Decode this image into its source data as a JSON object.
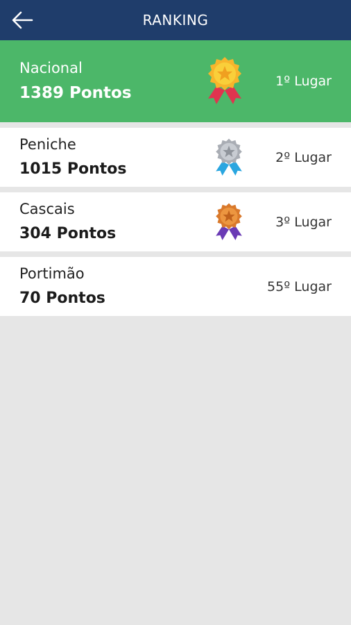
{
  "header": {
    "title": "RANKING",
    "back_icon": "back-arrow-icon"
  },
  "colors": {
    "header_bg": "#1f3d6b",
    "highlight_bg": "#4cb769",
    "page_bg": "#e6e6e6"
  },
  "rankings": [
    {
      "name": "Nacional",
      "points": "1389 Pontos",
      "place": "1º Lugar",
      "medal": "gold-medal-icon"
    },
    {
      "name": "Peniche",
      "points": "1015 Pontos",
      "place": "2º Lugar",
      "medal": "silver-medal-icon"
    },
    {
      "name": "Cascais",
      "points": "304 Pontos",
      "place": "3º Lugar",
      "medal": "bronze-medal-icon"
    },
    {
      "name": "Portimão",
      "points": "70 Pontos",
      "place": "55º Lugar"
    }
  ]
}
